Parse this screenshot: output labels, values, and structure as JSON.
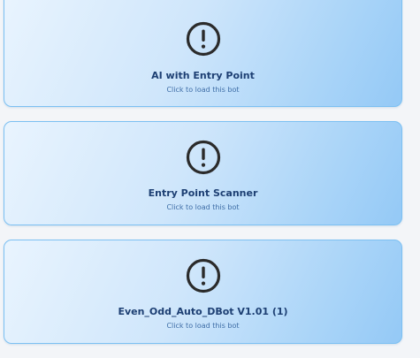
{
  "bots": [
    {
      "name": "AI with Entry Point",
      "hint": "Click to load this bot",
      "icon": "alert-circle-icon"
    },
    {
      "name": "Entry Point Scanner",
      "hint": "Click to load this bot",
      "icon": "alert-circle-icon"
    },
    {
      "name": "Even_Odd_Auto_DBot V1.01 (1)",
      "hint": "Click to load this bot",
      "icon": "alert-circle-icon"
    }
  ],
  "colors": {
    "card_border": "#7cc0f2",
    "card_gradient_start": "#e9f4fe",
    "card_gradient_end": "#94c9f6",
    "title_text": "#1d3f73",
    "hint_text": "#3e6da6",
    "icon": "#2b2b2b"
  }
}
